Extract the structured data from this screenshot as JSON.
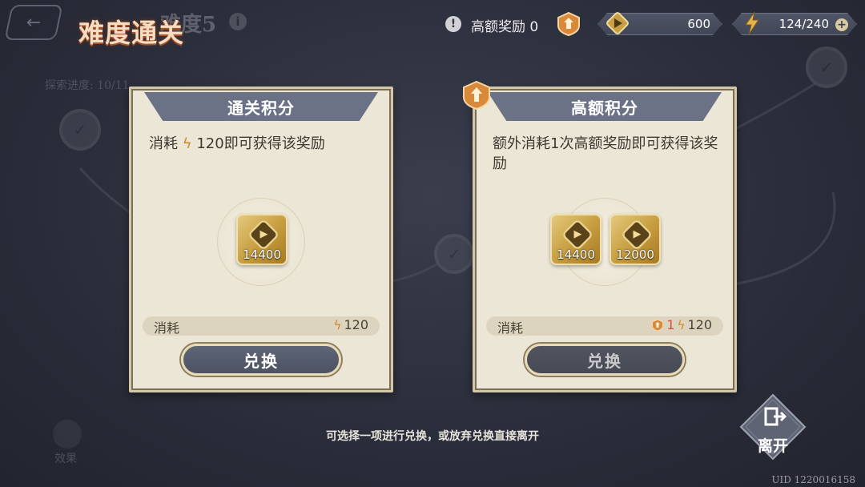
{
  "background": {
    "stage_title": "难度5",
    "info_icon": "info-icon",
    "progress_text": "探索进度: 10/11",
    "effect_label": "效果"
  },
  "header": {
    "title": "难度通关",
    "back_icon": "back-arrow-icon"
  },
  "resources": {
    "high_value_label": "高额奖励 0",
    "credit_amount": "600",
    "energy_amount": "124/240",
    "accent_gold": "#d08a24"
  },
  "cards": [
    {
      "header": "通关积分",
      "description_prefix": "消耗",
      "description_suffix": "120即可获得该奖励",
      "rewards": [
        {
          "quantity": "14400",
          "icon": "credit-coin-icon"
        }
      ],
      "cost_label": "消耗",
      "cost_energy": "120",
      "button": "兑换"
    },
    {
      "header": "高额积分",
      "description": "额外消耗1次高额奖励即可获得该奖励",
      "rewards": [
        {
          "quantity": "14400",
          "icon": "credit-coin-icon"
        },
        {
          "quantity": "12000",
          "icon": "credit-coin-icon"
        }
      ],
      "cost_label": "消耗",
      "cost_high_value": "1",
      "cost_energy": "120",
      "button": "兑换"
    }
  ],
  "footer": {
    "hint": "可选择一项进行兑换，或放弃兑换直接离开",
    "leave_label": "离开",
    "uid": "UID 1220016158"
  }
}
